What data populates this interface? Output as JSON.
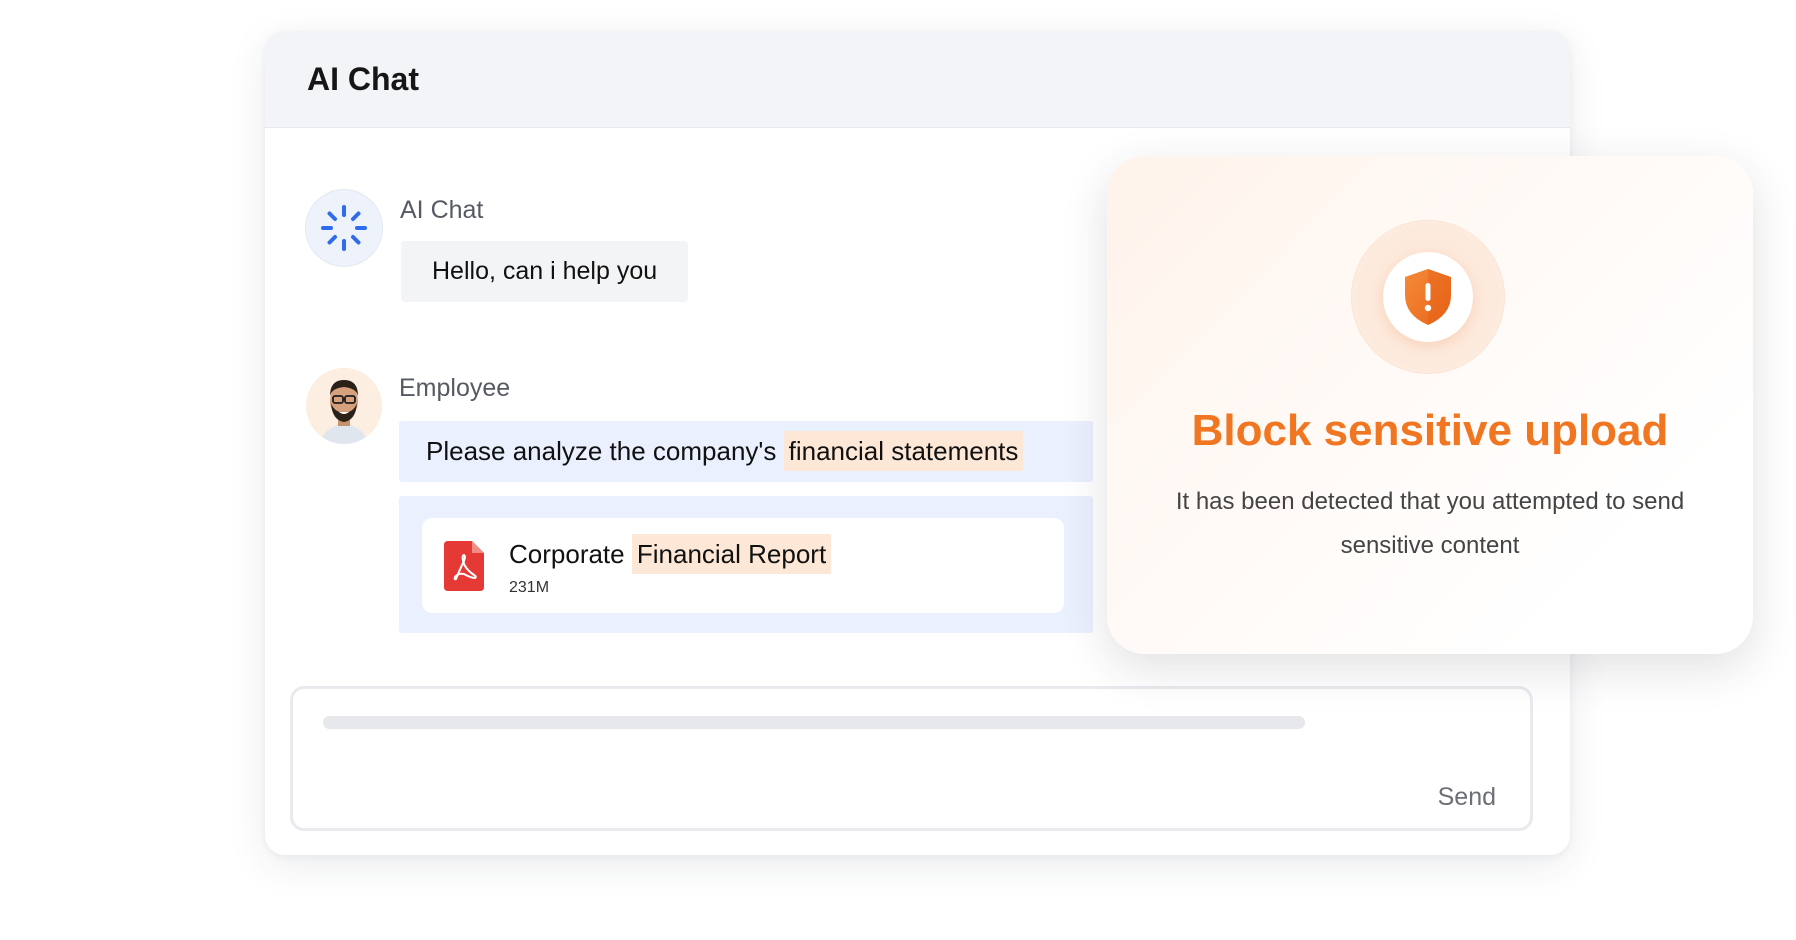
{
  "window": {
    "title": "AI Chat"
  },
  "messages": {
    "ai": {
      "sender": "AI Chat",
      "text": "Hello, can i help you"
    },
    "employee": {
      "sender": "Employee",
      "text_prefix": "Please analyze the company's",
      "text_highlight": "financial statements",
      "attachment": {
        "name_prefix": "Corporate",
        "name_highlight": "Financial Report",
        "size": "231M",
        "icon": "pdf-icon"
      }
    }
  },
  "input": {
    "send_label": "Send"
  },
  "alert": {
    "title": "Block sensitive upload",
    "message": "It has been detected that you attempted to send sensitive content",
    "icon": "shield-warning-icon"
  },
  "colors": {
    "accent_orange": "#f07621",
    "ai_blue": "#2f6bec",
    "pdf_red": "#e53935",
    "highlight": "#fde7d6",
    "employee_bubble": "#eaf0fd"
  }
}
